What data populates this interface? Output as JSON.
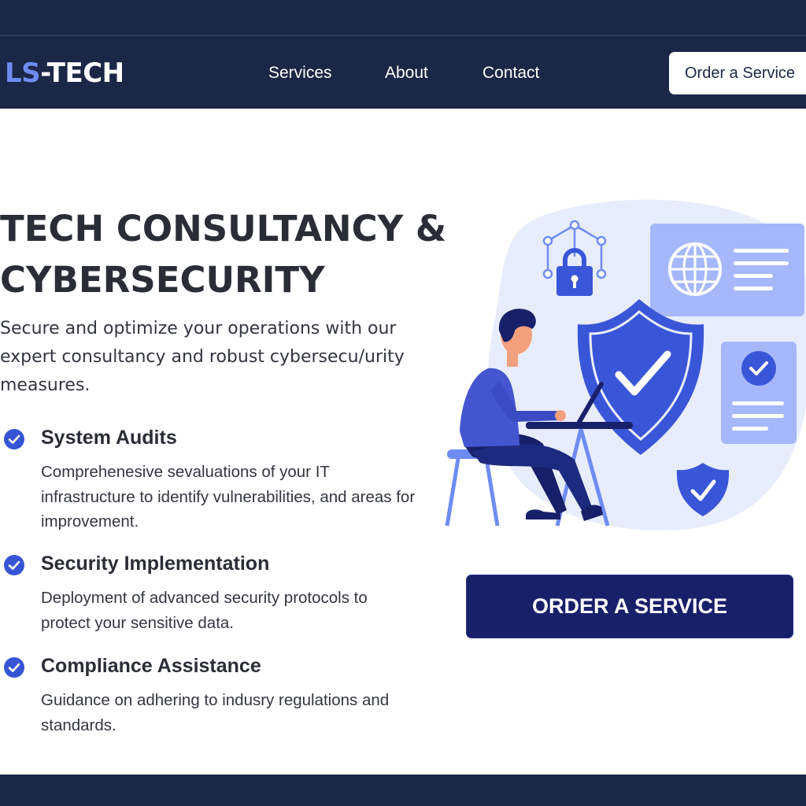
{
  "brand": {
    "logo_accent": "LS",
    "logo_rest": "-TECH",
    "accent_color": "#6f8cf3",
    "dark_color": "#1b2746"
  },
  "nav": {
    "links": [
      "Services",
      "About",
      "Contact"
    ],
    "order_button": "Order a Service"
  },
  "hero": {
    "title_line1": "TECH CONSULTANCY &",
    "title_line2": "CYBERSECURITY",
    "subtitle": "Secure and optimize your operations with our expert consultancy and robust cybersecu/urity measures."
  },
  "features": [
    {
      "icon": "check-circle-icon",
      "title": "System Audits",
      "description": "Comprehenesive sevaluations of your IT infrastructure to identify vulnerabilities, and areas for improvement."
    },
    {
      "icon": "check-circle-icon",
      "title": "Security Implementation",
      "description": "Deployment of advanced security protocols to protect your sensitive data."
    },
    {
      "icon": "check-circle-icon",
      "title": "Compliance Assistance",
      "description": "Guidance on adhering to indusry regulations and standards."
    }
  ],
  "illustration": {
    "icons": [
      "padlock-network-icon",
      "globe-icon",
      "shield-check-icon",
      "document-check-icon",
      "small-shield-check-icon",
      "person-at-laptop"
    ],
    "primary_color": "#3a56d8",
    "light_color": "#e8edfd"
  },
  "cta": {
    "label": "ORDER A SERVICE",
    "color": "#18206a"
  }
}
